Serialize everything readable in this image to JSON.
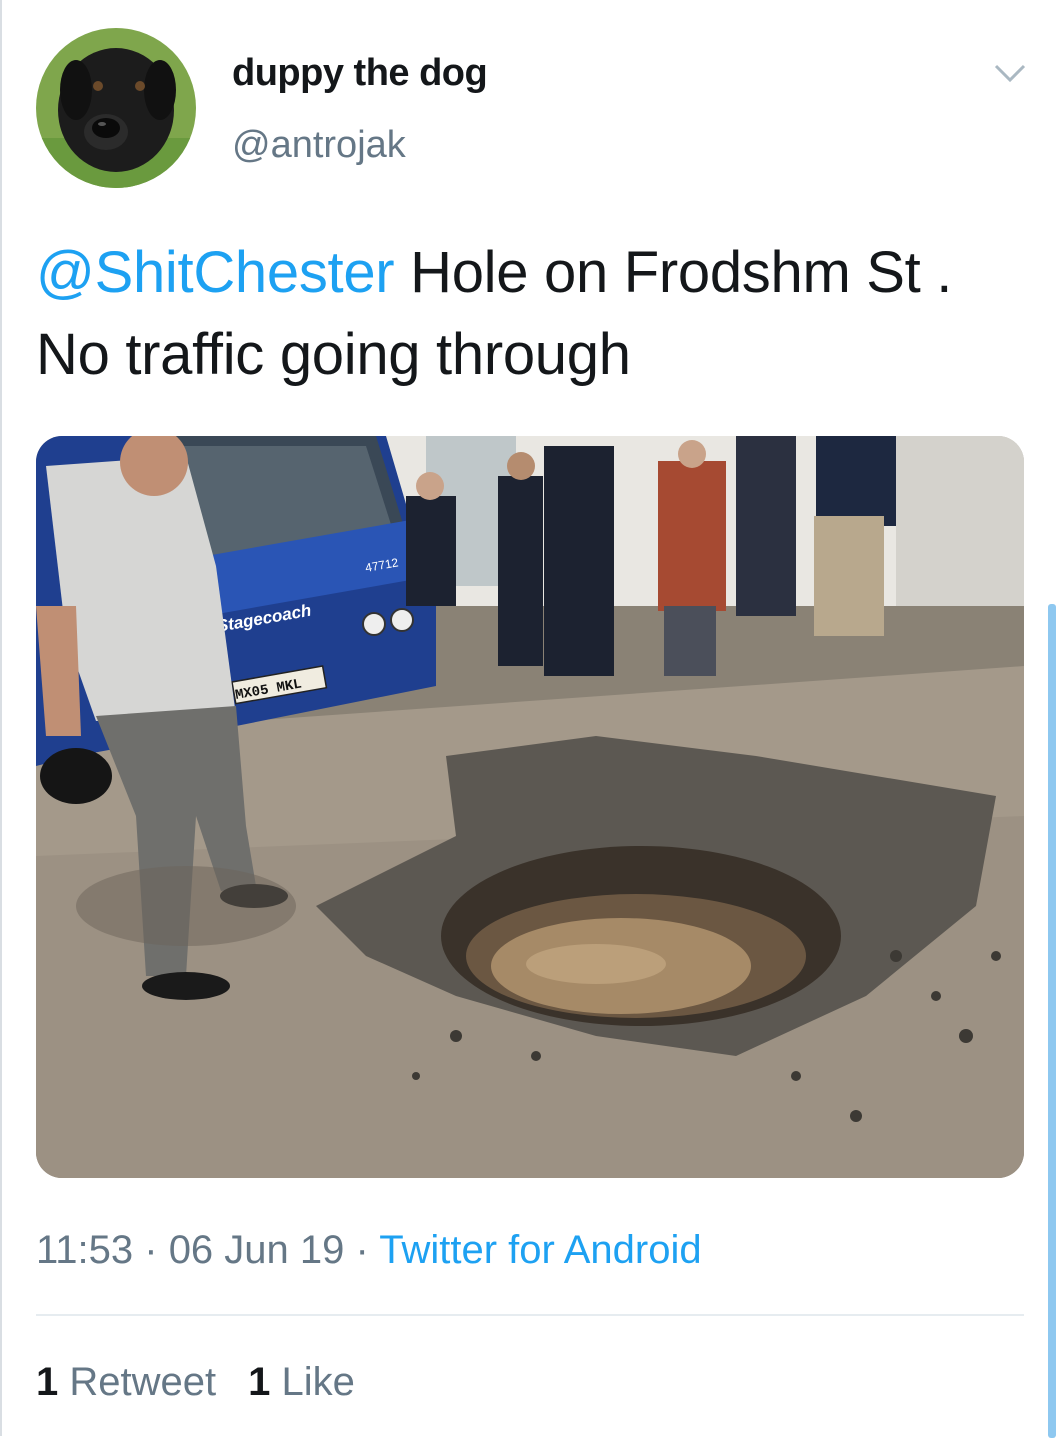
{
  "author": {
    "display_name": "duppy the dog",
    "handle": "@antrojak",
    "avatar_icon": "dog-avatar"
  },
  "tweet": {
    "mention": "@ShitChester",
    "text": " Hole on Frodshm St . No traffic going through"
  },
  "media": {
    "alt": "Pothole filled with water on Frodsham Street next to a Stagecoach bus",
    "bus_brand": "Stagecoach",
    "bus_number": "47712",
    "bus_plate": "MX05 MKL"
  },
  "meta": {
    "time": "11:53",
    "separator": " · ",
    "date": "06 Jun 19",
    "source": "Twitter for Android"
  },
  "stats": {
    "retweets_count": "1",
    "retweets_label": "Retweet",
    "likes_count": "1",
    "likes_label": "Like"
  },
  "colors": {
    "link": "#1da1f2",
    "secondary_text": "#657786",
    "primary_text": "#14171a"
  }
}
